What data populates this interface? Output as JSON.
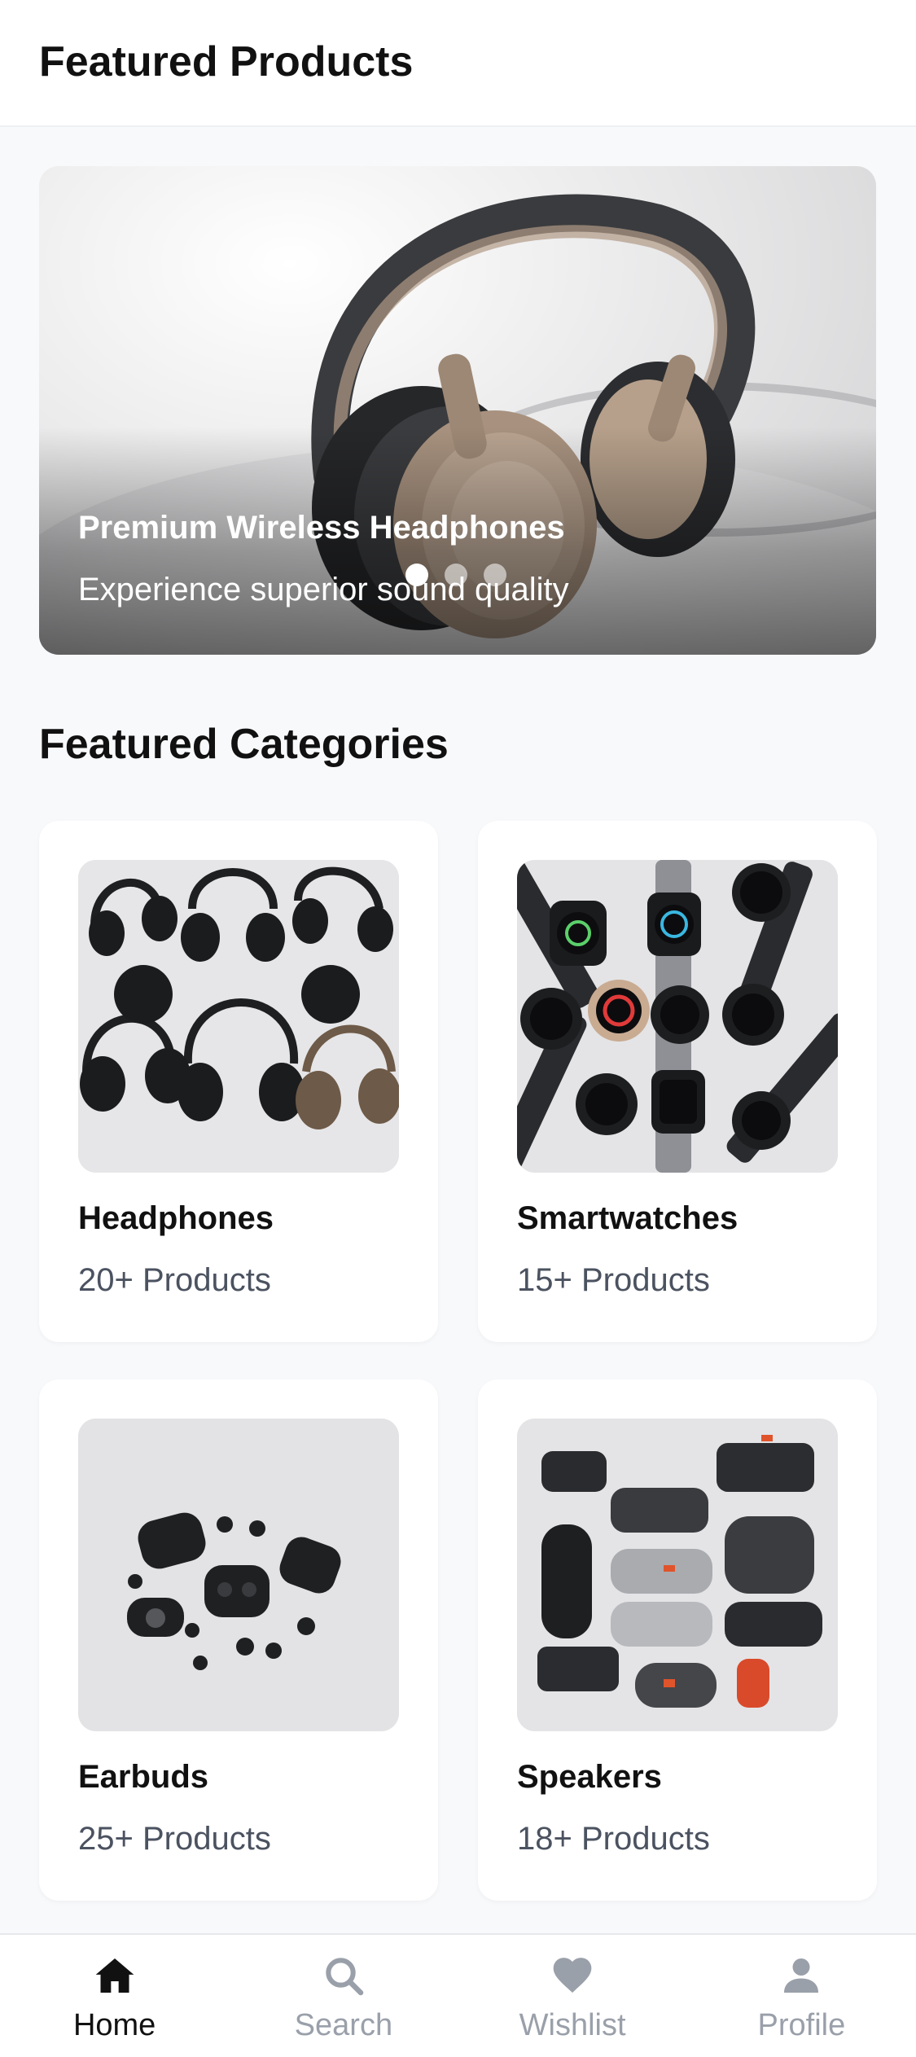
{
  "header": {
    "title": "Featured Products"
  },
  "hero": {
    "title": "Premium Wireless Headphones",
    "subtitle": "Experience superior sound quality",
    "slides": 3,
    "active_slide": 1
  },
  "categories_section": {
    "title": "Featured Categories",
    "items": [
      {
        "name": "Headphones",
        "count": "20+ Products"
      },
      {
        "name": "Smartwatches",
        "count": "15+ Products"
      },
      {
        "name": "Earbuds",
        "count": "25+ Products"
      },
      {
        "name": "Speakers",
        "count": "18+ Products"
      }
    ]
  },
  "bottom_nav": {
    "items": [
      {
        "label": "Home",
        "icon": "home-icon",
        "active": true
      },
      {
        "label": "Search",
        "icon": "search-icon",
        "active": false
      },
      {
        "label": "Wishlist",
        "icon": "heart-icon",
        "active": false
      },
      {
        "label": "Profile",
        "icon": "user-icon",
        "active": false
      }
    ]
  },
  "colors": {
    "background": "#f8f9fb",
    "card": "#ffffff",
    "text_primary": "#111111",
    "text_secondary": "#4b5260",
    "nav_inactive": "#9aa0aa"
  }
}
